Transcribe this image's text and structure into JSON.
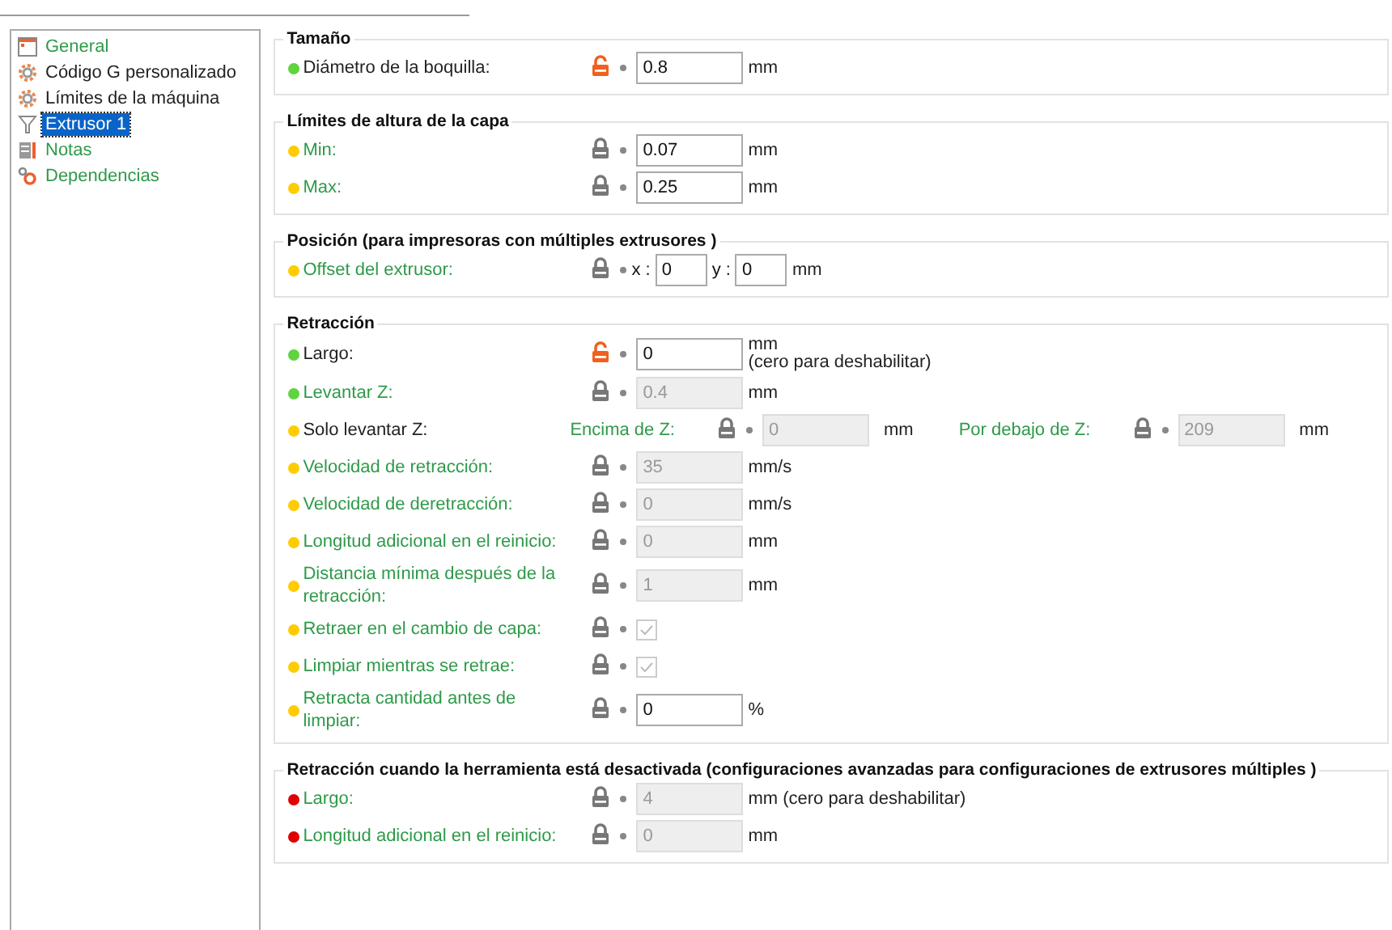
{
  "sidebar": {
    "items": [
      {
        "kind": "window",
        "label": "General",
        "system_value": true,
        "selected": false
      },
      {
        "kind": "gear",
        "label": "Código G personalizado",
        "system_value": false,
        "selected": false
      },
      {
        "kind": "gear",
        "label": "Límites de la máquina",
        "system_value": false,
        "selected": false
      },
      {
        "kind": "funnel",
        "label": "Extrusor 1",
        "system_value": false,
        "selected": true
      },
      {
        "kind": "notes",
        "label": "Notas",
        "system_value": true,
        "selected": false
      },
      {
        "kind": "deps",
        "label": "Dependencias",
        "system_value": true,
        "selected": false
      }
    ]
  },
  "groups": [
    {
      "title": "Tamaño",
      "rows": [
        {
          "kind": "field",
          "label": "Diámetro de la boquilla:",
          "color": "#5ed43f",
          "system_value": false,
          "locked": false,
          "value": "0.8",
          "disabled": false,
          "unit": "mm"
        }
      ]
    },
    {
      "title": "Límites de altura de la capa",
      "rows": [
        {
          "kind": "field",
          "label": "Min:",
          "color": "#ffcc00",
          "system_value": true,
          "locked": true,
          "value": "0.07",
          "disabled": false,
          "unit": "mm"
        },
        {
          "kind": "field",
          "label": "Max:",
          "color": "#ffcc00",
          "system_value": true,
          "locked": true,
          "value": "0.25",
          "disabled": false,
          "unit": "mm"
        }
      ]
    },
    {
      "title": "Posición (para impresoras con múltiples extrusores )",
      "rows": [
        {
          "kind": "xy",
          "label": "Offset del extrusor:",
          "color": "#ffcc00",
          "system_value": true,
          "locked": true,
          "parts": [
            {
              "axis": "x :",
              "value": "0"
            },
            {
              "axis": "y :",
              "value": "0"
            }
          ],
          "unit": "mm"
        }
      ]
    },
    {
      "title": "Retracción",
      "rows": [
        {
          "kind": "field",
          "label": "Largo:",
          "color": "#5ed43f",
          "system_value": false,
          "locked": false,
          "value": "0",
          "disabled": false,
          "unit": "mm",
          "note": "(cero para deshabilitar)"
        },
        {
          "kind": "field",
          "label": "Levantar Z:",
          "color": "#5ed43f",
          "system_value": true,
          "locked": true,
          "value": "0.4",
          "disabled": true,
          "unit": "mm"
        },
        {
          "kind": "zrange",
          "label": "Solo levantar Z:",
          "color": "#ffcc00",
          "system_value": false,
          "parts": [
            {
              "label": "Encima de Z:",
              "locked": true,
              "value": "0",
              "disabled": true,
              "unit": "mm"
            },
            {
              "label": "Por debajo de Z:",
              "locked": true,
              "value": "209",
              "disabled": true,
              "unit": "mm"
            }
          ]
        },
        {
          "kind": "field",
          "label": "Velocidad de retracción:",
          "color": "#ffcc00",
          "system_value": true,
          "locked": true,
          "value": "35",
          "disabled": true,
          "unit": "mm/s"
        },
        {
          "kind": "field",
          "label": "Velocidad de deretracción:",
          "color": "#ffcc00",
          "system_value": true,
          "locked": true,
          "value": "0",
          "disabled": true,
          "unit": "mm/s"
        },
        {
          "kind": "field",
          "label": "Longitud adicional en el reinicio:",
          "color": "#ffcc00",
          "system_value": true,
          "locked": true,
          "value": "0",
          "disabled": true,
          "unit": "mm"
        },
        {
          "kind": "field",
          "label": "Distancia mínima después de la retracción:",
          "color": "#ffcc00",
          "system_value": true,
          "locked": true,
          "value": "1",
          "disabled": true,
          "unit": "mm"
        },
        {
          "kind": "checkbox",
          "label": "Retraer en el cambio de capa:",
          "color": "#ffcc00",
          "system_value": true,
          "locked": true,
          "checked": true,
          "disabled": true
        },
        {
          "kind": "checkbox",
          "label": "Limpiar mientras se retrae:",
          "color": "#ffcc00",
          "system_value": true,
          "locked": true,
          "checked": true,
          "disabled": true
        },
        {
          "kind": "field",
          "label": "Retracta cantidad antes de limpiar:",
          "color": "#ffcc00",
          "system_value": true,
          "locked": true,
          "value": "0",
          "disabled": false,
          "unit": "%"
        }
      ]
    },
    {
      "title": "Retracción cuando la herramienta está desactivada (configuraciones avanzadas para configuraciones de extrusores múltiples )",
      "rows": [
        {
          "kind": "field",
          "label": "Largo:",
          "color": "#e00000",
          "system_value": true,
          "locked": true,
          "value": "4",
          "disabled": true,
          "unit": "mm (cero para deshabilitar)"
        },
        {
          "kind": "field",
          "label": "Longitud adicional en el reinicio:",
          "color": "#e00000",
          "system_value": true,
          "locked": true,
          "value": "0",
          "disabled": true,
          "unit": "mm"
        }
      ]
    }
  ]
}
